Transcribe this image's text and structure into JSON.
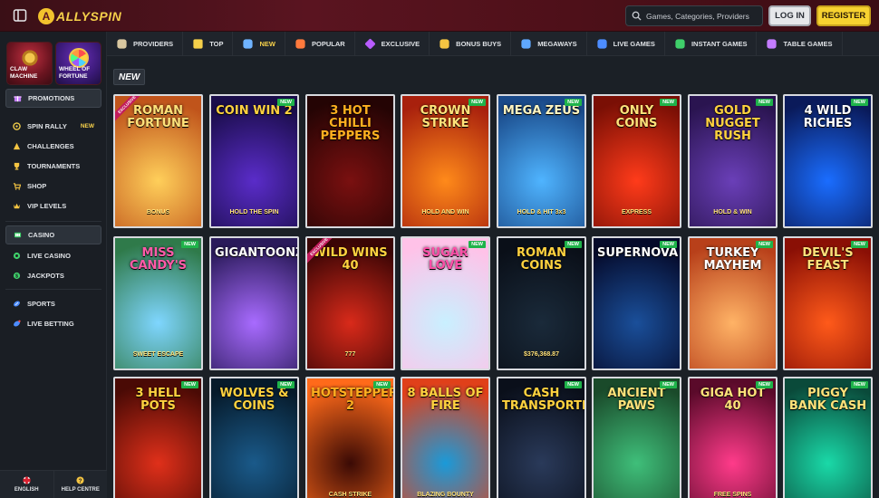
{
  "header": {
    "logo_mark": "A",
    "logo_text": "ALLYSPIN",
    "search_placeholder": "Games, Categories, Providers",
    "login_label": "LOG IN",
    "register_label": "REGISTER"
  },
  "sidebar": {
    "tiles": [
      {
        "label": "CLAW MACHINE"
      },
      {
        "label": "WHEEL OF FORTUNE"
      }
    ],
    "items": [
      {
        "label": "PROMOTIONS",
        "icon": "gift-icon"
      },
      {
        "label": "SPIN RALLY",
        "icon": "spin-rally-icon",
        "badge": "NEW"
      },
      {
        "label": "CHALLENGES",
        "icon": "challenges-icon"
      },
      {
        "label": "TOURNAMENTS",
        "icon": "trophy-icon"
      },
      {
        "label": "SHOP",
        "icon": "shop-icon"
      },
      {
        "label": "VIP LEVELS",
        "icon": "vip-icon"
      },
      {
        "label": "CASINO",
        "icon": "casino-icon"
      },
      {
        "label": "LIVE CASINO",
        "icon": "live-casino-icon"
      },
      {
        "label": "JACKPOTS",
        "icon": "jackpot-icon"
      },
      {
        "label": "SPORTS",
        "icon": "sports-icon"
      },
      {
        "label": "LIVE BETTING",
        "icon": "live-betting-icon"
      }
    ],
    "footer": [
      {
        "label": "ENGLISH",
        "icon": "flag-icon"
      },
      {
        "label": "HELP CENTRE",
        "icon": "help-icon"
      }
    ]
  },
  "categories": [
    {
      "label": "PROVIDERS",
      "icon": "providers-icon",
      "color": "#d9c7a0"
    },
    {
      "label": "TOP",
      "icon": "star-icon",
      "color": "#f5d04a"
    },
    {
      "label": "NEW",
      "icon": "new-icon",
      "color": "#6fb3ff"
    },
    {
      "label": "POPULAR",
      "icon": "fire-icon",
      "color": "#ff7a3d"
    },
    {
      "label": "EXCLUSIVE",
      "icon": "diamond-icon",
      "color": "#b85cff"
    },
    {
      "label": "BONUS BUYS",
      "icon": "bonus-icon",
      "color": "#f5c542"
    },
    {
      "label": "MEGAWAYS",
      "icon": "megaways-icon",
      "color": "#5fa8ff"
    },
    {
      "label": "LIVE GAMES",
      "icon": "play-icon",
      "color": "#4d8dff"
    },
    {
      "label": "INSTANT GAMES",
      "icon": "instant-icon",
      "color": "#3fcf6a"
    },
    {
      "label": "TABLE GAMES",
      "icon": "cards-icon",
      "color": "#c47cff"
    }
  ],
  "section": {
    "title": "NEW"
  },
  "games": [
    {
      "title": "ROMAN FORTUNE",
      "tag": "EXCLUSIVE",
      "sub": "BONUS",
      "bg": [
        "#ffcf5a",
        "#c0541b"
      ],
      "fg": "#ffe27a"
    },
    {
      "title": "COIN WIN 2",
      "tag": "NEW",
      "sub": "HOLD THE SPIN",
      "bg": [
        "#5a2cc9",
        "#1a0d4a"
      ],
      "fg": "#ffd23f"
    },
    {
      "title": "3 HOT CHILLI PEPPERS",
      "tag": "",
      "sub": "",
      "bg": [
        "#7a1010",
        "#240404"
      ],
      "fg": "#ffb020"
    },
    {
      "title": "CROWN STRIKE",
      "tag": "NEW",
      "sub": "HOLD AND WIN",
      "bg": [
        "#ff8a1a",
        "#a8200d"
      ],
      "fg": "#ffe27a"
    },
    {
      "title": "MEGA ZEUS",
      "tag": "NEW",
      "sub": "HOLD & HIT 3x3",
      "bg": [
        "#4fb4ff",
        "#1a4a8a"
      ],
      "fg": "#fff5c0"
    },
    {
      "title": "ONLY COINS",
      "tag": "NEW",
      "sub": "EXPRESS",
      "bg": [
        "#ff3b1a",
        "#7a0f05"
      ],
      "fg": "#ffe27a"
    },
    {
      "title": "GOLD NUGGET RUSH",
      "tag": "NEW",
      "sub": "HOLD & WIN",
      "bg": [
        "#6a3fb8",
        "#2a1450"
      ],
      "fg": "#ffd23f"
    },
    {
      "title": "4 WILD RICHES",
      "tag": "NEW",
      "sub": "",
      "bg": [
        "#1a6dff",
        "#0a1a5a"
      ],
      "fg": "#ffffff"
    },
    {
      "title": "MISS CANDY'S",
      "tag": "NEW",
      "sub": "SWEET ESCAPE",
      "bg": [
        "#7fd6ff",
        "#2f7a4a"
      ],
      "fg": "#ff5aa8"
    },
    {
      "title": "GIGANTOONZ",
      "tag": "",
      "sub": "",
      "bg": [
        "#a86bff",
        "#2a1a5a"
      ],
      "fg": "#ffffff"
    },
    {
      "title": "WILD WINS 40",
      "tag": "EXCLUSIVE",
      "sub": "777",
      "bg": [
        "#d92a1a",
        "#3a0505"
      ],
      "fg": "#ffd23f"
    },
    {
      "title": "SUGAR LOVE",
      "tag": "NEW",
      "sub": "",
      "bg": [
        "#c9f0ff",
        "#ffc2e8"
      ],
      "fg": "#ff4fa8"
    },
    {
      "title": "ROMAN COINS",
      "tag": "NEW",
      "sub": "$376,368.87",
      "bg": [
        "#1a2a3a",
        "#0a0f18"
      ],
      "fg": "#ffd23f"
    },
    {
      "title": "SUPERNOVA",
      "tag": "NEW",
      "sub": "",
      "bg": [
        "#1a4f9a",
        "#050a2a"
      ],
      "fg": "#ffffff"
    },
    {
      "title": "TURKEY MAYHEM",
      "tag": "NEW",
      "sub": "",
      "bg": [
        "#ffb366",
        "#b8401a"
      ],
      "fg": "#ffffff"
    },
    {
      "title": "DEVIL'S FEAST",
      "tag": "NEW",
      "sub": "",
      "bg": [
        "#ff5a1a",
        "#8a0f05"
      ],
      "fg": "#ffe27a"
    },
    {
      "title": "3 HELL POTS",
      "tag": "NEW",
      "sub": "",
      "bg": [
        "#e0301a",
        "#4a0a05"
      ],
      "fg": "#ffd23f"
    },
    {
      "title": "WOLVES & COINS",
      "tag": "NEW",
      "sub": "",
      "bg": [
        "#1a5a8a",
        "#061a2a"
      ],
      "fg": "#ffd23f"
    },
    {
      "title": "HOTSTEPPER 2",
      "tag": "NEW",
      "sub": "CASH STRIKE",
      "bg": [
        "#3a0a05",
        "#ff6a1a"
      ],
      "fg": "#ffb020"
    },
    {
      "title": "8 BALLS OF FIRE",
      "tag": "",
      "sub": "BLAZING BOUNTY",
      "bg": [
        "#1a9ad9",
        "#e0401a"
      ],
      "fg": "#ffd23f"
    },
    {
      "title": "CASH TRANSPORTER",
      "tag": "NEW",
      "sub": "",
      "bg": [
        "#2a3a5a",
        "#0a0f1a"
      ],
      "fg": "#ffd23f"
    },
    {
      "title": "ANCIENT PAWS",
      "tag": "NEW",
      "sub": "",
      "bg": [
        "#3fbf7a",
        "#1a4a2a"
      ],
      "fg": "#ffe27a"
    },
    {
      "title": "GIGA HOT 40",
      "tag": "NEW",
      "sub": "FREE SPINS",
      "bg": [
        "#ff3b8a",
        "#5a0a2a"
      ],
      "fg": "#ffe27a"
    },
    {
      "title": "PIGGY BANK CASH",
      "tag": "NEW",
      "sub": "",
      "bg": [
        "#1ad9a8",
        "#0a4a3a"
      ],
      "fg": "#ffe27a"
    }
  ]
}
